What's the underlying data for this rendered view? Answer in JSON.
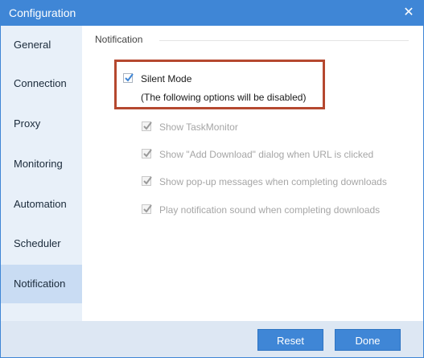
{
  "window": {
    "title": "Configuration",
    "close_icon": "close-icon"
  },
  "sidebar": {
    "items": [
      {
        "label": "General"
      },
      {
        "label": "Connection"
      },
      {
        "label": "Proxy"
      },
      {
        "label": "Monitoring"
      },
      {
        "label": "Automation"
      },
      {
        "label": "Scheduler"
      },
      {
        "label": "Notification",
        "selected": true
      }
    ]
  },
  "main": {
    "section_title": "Notification",
    "silent_mode": {
      "label": "Silent Mode",
      "checked": true
    },
    "silent_note": "(The following options will be disabled)",
    "options": [
      {
        "label": "Show TaskMonitor",
        "checked": true,
        "enabled": false
      },
      {
        "label": "Show \"Add Download\" dialog when URL is clicked",
        "checked": true,
        "enabled": false
      },
      {
        "label": "Show pop-up messages when completing downloads",
        "checked": true,
        "enabled": false
      },
      {
        "label": "Play notification sound when completing downloads",
        "checked": true,
        "enabled": false
      }
    ]
  },
  "footer": {
    "reset_label": "Reset",
    "done_label": "Done"
  },
  "colors": {
    "accent": "#3f86d6",
    "highlight_border": "#b5482f",
    "sidebar_bg": "#e8f0f9",
    "sidebar_selected": "#c9dcf3"
  }
}
